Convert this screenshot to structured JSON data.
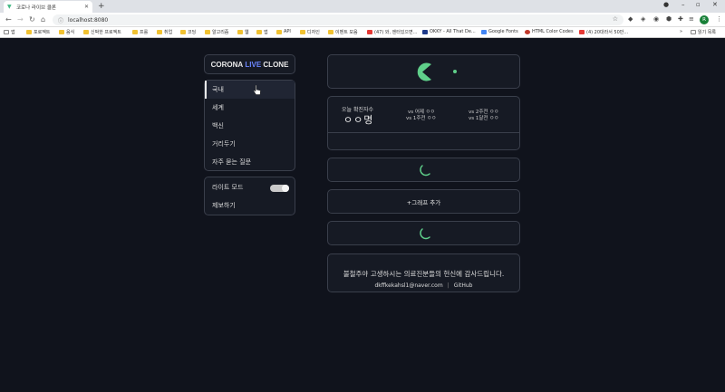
{
  "browser": {
    "tab_title": "코로나 라이브 클론",
    "url": "localhost:8080",
    "profile_initial": "R",
    "bookmarks": [
      "앱",
      "포로젝트",
      "음식",
      "신박한 프로젝트",
      "프롤",
      "취업",
      "코딩",
      "알고리즘",
      "웹",
      "앱",
      "API",
      "디자인",
      "이벤트 모음",
      "(47) 와, 엔터있으면...",
      "OKKY - All That De...",
      "Google Fonts",
      "HTML Color Codes",
      "(4) 20대라서 50만...",
      "읽기 목록"
    ]
  },
  "logo": {
    "part1": "CORONA",
    "part2": "LIVE",
    "part3": "CLONE",
    "accent_color": "#6b86ff"
  },
  "menu": {
    "items": [
      {
        "label": "국내"
      },
      {
        "label": "세계"
      },
      {
        "label": "백신"
      },
      {
        "label": "거리두기"
      },
      {
        "label": "자주 묻는 질문"
      }
    ],
    "active": "국내"
  },
  "settings": {
    "light_mode_label": "라이트 모드",
    "light_mode_on": false,
    "report_label": "제보하기"
  },
  "stats": {
    "today_label": "오늘 확진자수",
    "today_value": "ㅇㅇ명",
    "vs_yesterday": "vs 어제 ㅇㅇ",
    "vs_1week": "vs 1주전 ㅇㅇ",
    "vs_2weeks": "vs 2주전 ㅇㅇ",
    "vs_1month": "vs 1달전 ㅇㅇ"
  },
  "add_graph_label": "+그래프 추가",
  "footer": {
    "thanks": "불철주야 고생하시는 의료진분들의 헌신에 감사드립니다.",
    "email": "dkffkekahsl1@naver.com",
    "separator": "|",
    "github": "GitHub"
  },
  "colors": {
    "background": "#10131c",
    "card_border": "#3a3f4b",
    "pacman": "#5fcf8a"
  }
}
